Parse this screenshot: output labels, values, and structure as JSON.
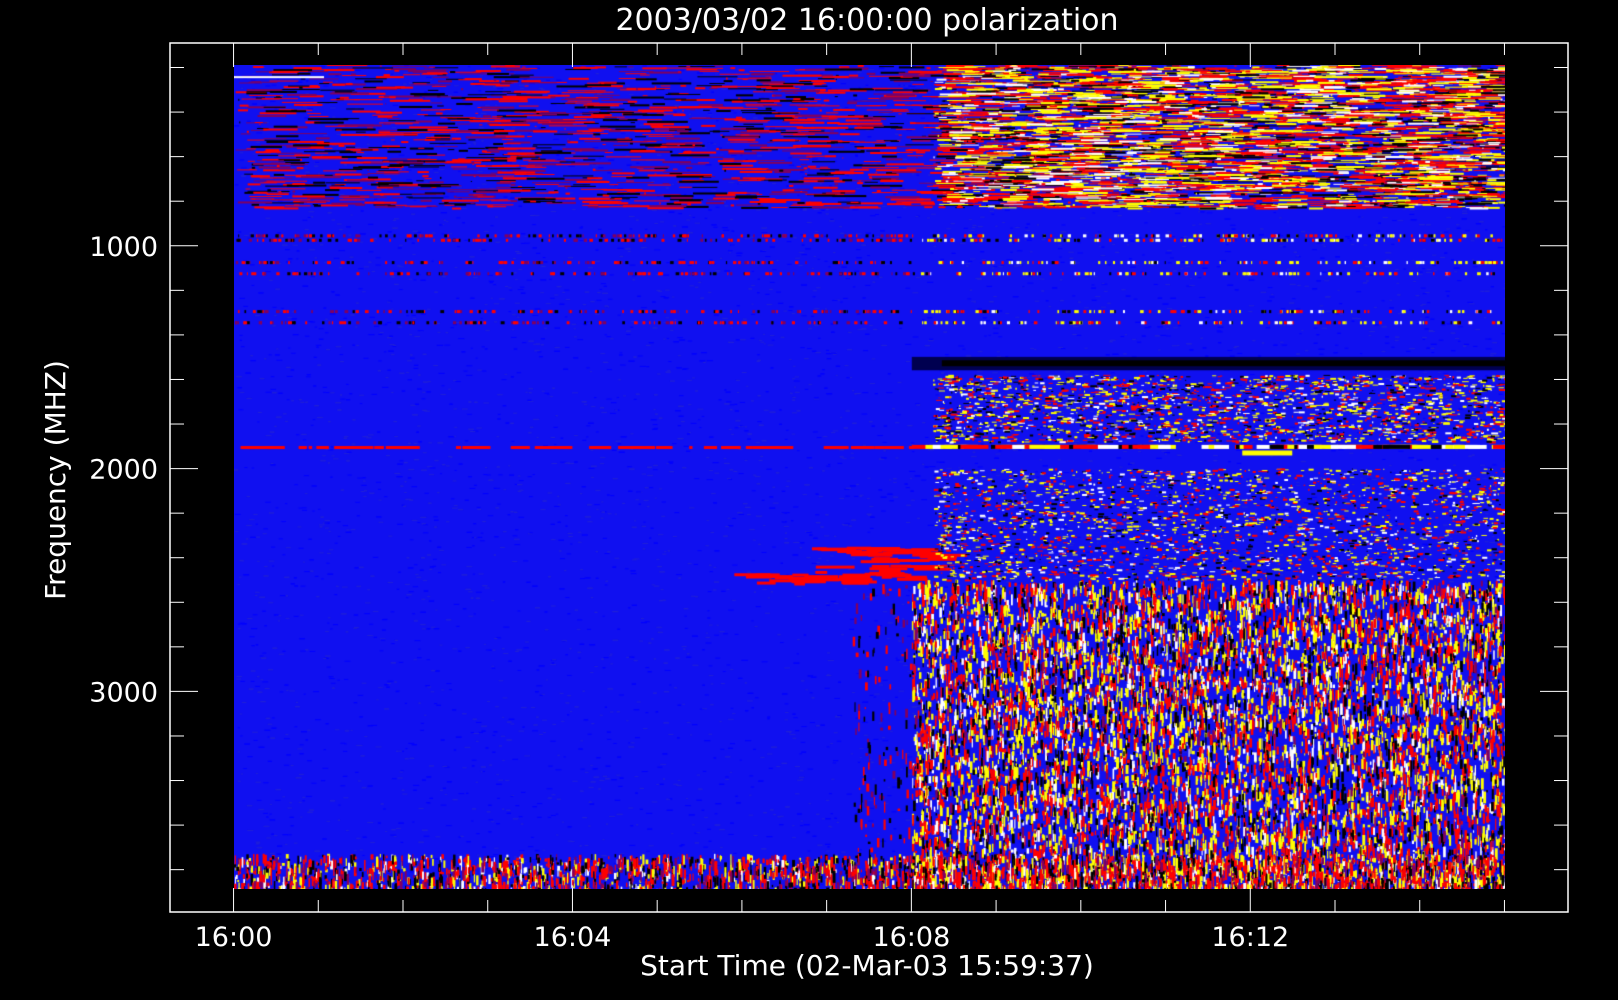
{
  "chart_data": {
    "type": "heatmap",
    "title": "2003/03/02 16:00:00 polarization",
    "xlabel": "Start Time (02-Mar-03 15:59:37)",
    "ylabel": "Frequency (MHZ)",
    "xticks": [
      "16:00",
      "16:04",
      "16:08",
      "16:12"
    ],
    "xtick_minutes": [
      0,
      4,
      8,
      12
    ],
    "yticks": [
      1000,
      2000,
      3000
    ],
    "xlim_minutes": [
      -0.75,
      15.75
    ],
    "ylim": [
      3990,
      90
    ],
    "data_extent": {
      "x_minutes": [
        0,
        15
      ],
      "y_mhz": [
        190,
        3890
      ]
    },
    "colormap": [
      "#000000",
      "#0000ff",
      "#ff0000",
      "#ffff00",
      "#ffffff"
    ],
    "background_color": "#1010f0",
    "grid": false,
    "bands": [
      {
        "y_mhz": [
          190,
          830
        ],
        "level": 0.85,
        "note": "dense red/yellow/white streaks"
      },
      {
        "y_mhz": [
          920,
          1000
        ],
        "level": 0.45
      },
      {
        "y_mhz": [
          1480,
          1560
        ],
        "level": 0.6,
        "note": "dark band after 16:08"
      },
      {
        "y_mhz": [
          1890,
          1930
        ],
        "level": 0.9,
        "note": "bright yellow/white streak"
      },
      {
        "y_mhz": [
          2310,
          2490
        ],
        "level": 0.6,
        "note": "red streaks near 16:07"
      },
      {
        "y_mhz": [
          2550,
          3890
        ],
        "level": 0.9,
        "note": "yellow speckle after 16:08"
      },
      {
        "y_mhz": [
          3730,
          3890
        ],
        "level": 0.8,
        "note": "bottom noise band full width"
      }
    ]
  }
}
